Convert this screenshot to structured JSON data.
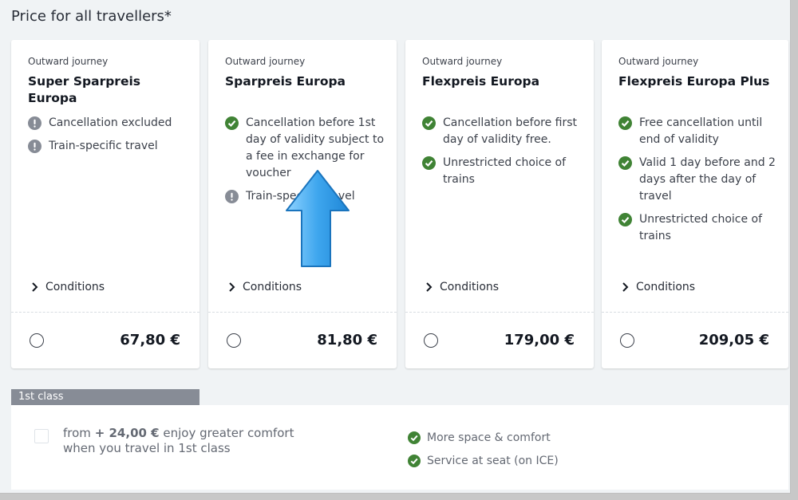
{
  "heading": "Price for all travellers*",
  "cards": [
    {
      "label": "Outward journey",
      "title": "Super Sparpreis Europa",
      "features": [
        {
          "icon": "warning-icon",
          "text": "Cancellation excluded"
        },
        {
          "icon": "warning-icon",
          "text": "Train-specific travel"
        }
      ],
      "conditions_label": "Conditions",
      "price": "67,80 €"
    },
    {
      "label": "Outward journey",
      "title": "Sparpreis Europa",
      "features": [
        {
          "icon": "check-icon",
          "text": "Cancellation before 1st day of validity subject to a fee in exchange for voucher"
        },
        {
          "icon": "warning-icon",
          "text": "Train-specific travel"
        }
      ],
      "conditions_label": "Conditions",
      "price": "81,80 €"
    },
    {
      "label": "Outward journey",
      "title": "Flexpreis Europa",
      "features": [
        {
          "icon": "check-icon",
          "text": "Cancellation before first day of validity free."
        },
        {
          "icon": "check-icon",
          "text": "Unrestricted choice of trains"
        }
      ],
      "conditions_label": "Conditions",
      "price": "179,00 €"
    },
    {
      "label": "Outward journey",
      "title": "Flexpreis Europa Plus",
      "features": [
        {
          "icon": "check-icon",
          "text": "Free cancellation until end of validity"
        },
        {
          "icon": "check-icon",
          "text": "Valid 1 day before and 2 days after the day of travel"
        },
        {
          "icon": "check-icon",
          "text": "Unrestricted choice of trains"
        }
      ],
      "conditions_label": "Conditions",
      "price": "209,05 €"
    }
  ],
  "first_class": {
    "tab_label": "1st class",
    "upgrade_prefix": "from",
    "upgrade_amount": "+ 24,00 €",
    "upgrade_suffix": "enjoy greater comfort when you travel in 1st class",
    "benefits": [
      {
        "icon": "check-icon",
        "text": "More space & comfort"
      },
      {
        "icon": "check-icon",
        "text": "Service at seat (on ICE)"
      }
    ]
  },
  "colors": {
    "check": "#408335",
    "warning": "#878c96",
    "arrow": "#3ea6ee"
  }
}
